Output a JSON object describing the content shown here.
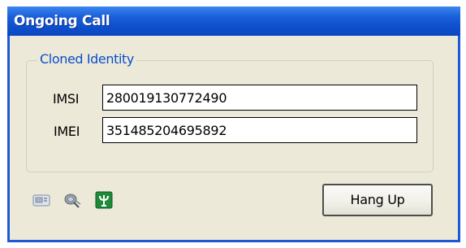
{
  "window": {
    "title": "Ongoing Call"
  },
  "cloned_identity": {
    "legend": "Cloned Identity",
    "imsi_label": "IMSI",
    "imsi_value": "280019130772490",
    "imei_label": "IMEI",
    "imei_value": "351485204695892"
  },
  "toolbar_icons": [
    "sim-card-icon",
    "satellite-icon",
    "antenna-icon"
  ],
  "actions": {
    "hang_up_label": "Hang Up"
  },
  "colors": {
    "titlebar": "#0a47c2",
    "window_body": "#ece9d8",
    "legend_text": "#0a4dcc",
    "antenna_icon": "#1e8a3a"
  }
}
